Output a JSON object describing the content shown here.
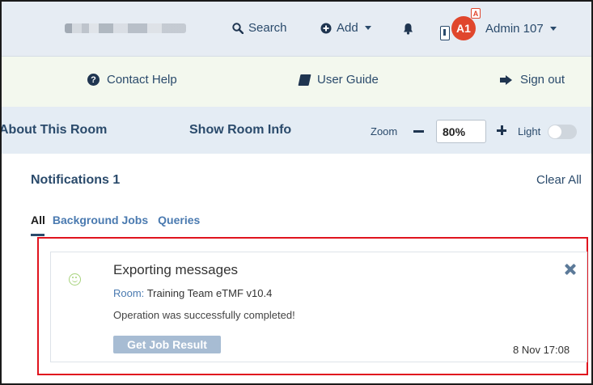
{
  "topnav": {
    "search_label": "Search",
    "add_label": "Add",
    "avatar_initials": "A1",
    "avatar_badge": "A",
    "user_name": "Admin 107"
  },
  "helpbar": {
    "contact_label": "Contact Help",
    "guide_label": "User Guide",
    "signout_label": "Sign out"
  },
  "roombar": {
    "about_label": "About This Room",
    "info_label": "Show Room Info",
    "zoom_label": "Zoom",
    "zoom_value": "80%",
    "light_label": "Light",
    "light_on": false
  },
  "notifications": {
    "title": "Notifications 1",
    "clear_label": "Clear All",
    "tabs": [
      {
        "label": "All",
        "active": true
      },
      {
        "label": "Background Jobs",
        "active": false
      },
      {
        "label": "Queries",
        "active": false
      }
    ],
    "items": [
      {
        "title": "Exporting messages",
        "room_label": "Room:",
        "room_name": "Training Team eTMF v10.4",
        "message": "Operation was successfully completed!",
        "action_label": "Get Job Result",
        "time": "8 Nov 17:08"
      }
    ]
  },
  "colors": {
    "nav_text": "#2a4a6b",
    "avatar": "#e0462c",
    "highlight_border": "#e0141e",
    "button_bg": "#a7bcd3",
    "success_icon": "#a6d27b"
  },
  "icons": [
    "search-icon",
    "plus-circle-icon",
    "bell-icon",
    "phone-icon",
    "question-circle-icon",
    "book-icon",
    "sign-out-icon",
    "smile-icon",
    "close-icon"
  ]
}
